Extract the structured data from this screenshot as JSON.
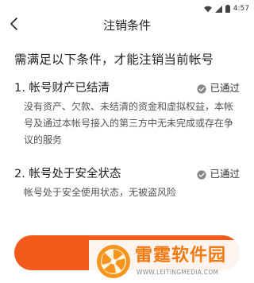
{
  "status_bar": {
    "time": "4:57",
    "icons": [
      "wifi-icon",
      "signal-icon",
      "battery-icon"
    ]
  },
  "nav": {
    "title": "注销条件",
    "back_icon": "back-arrow-icon"
  },
  "heading": "需满足以下条件，才能注销当前帐号",
  "conditions": [
    {
      "title": "1. 帐号财产已结清",
      "status": "已通过",
      "description": "没有资产、欠款、未结清的资金和虚拟权益，本帐号及通过本帐号接入的第三方中无未完成或存在争议的服务"
    },
    {
      "title": "2. 帐号处于安全状态",
      "status": "已通过",
      "description": "帐号处于安全使用状态，无被盗风险"
    }
  ],
  "colors": {
    "accent": "#f45a1c",
    "status_check": "#888888",
    "watermark": "#f07a10"
  },
  "watermark": {
    "name": "雷霆软件园",
    "url": "WWW.LEITINGMEDIA.COM"
  }
}
